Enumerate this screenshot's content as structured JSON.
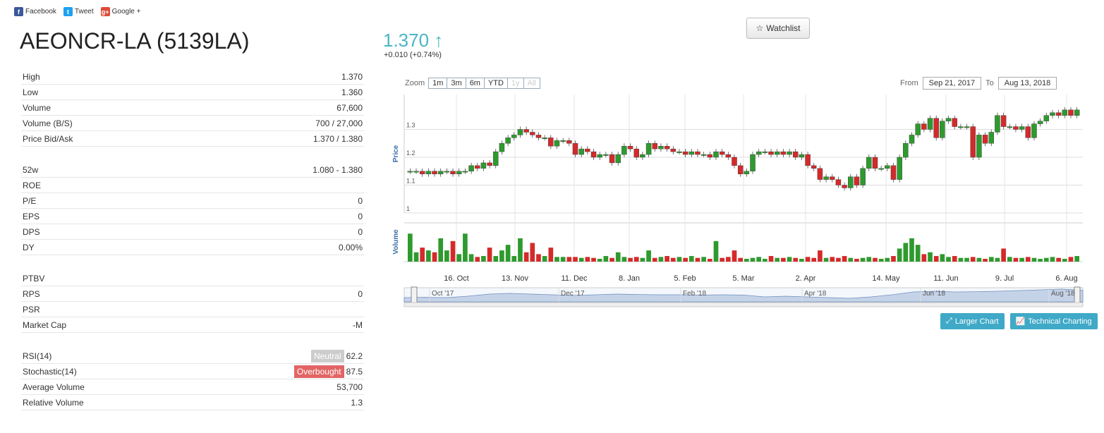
{
  "share": {
    "facebook": "Facebook",
    "tweet": "Tweet",
    "google": "Google +"
  },
  "title": "AEONCR-LA (5139LA)",
  "price": {
    "value": "1.370 ↑",
    "change": "+0.010 (+0.74%)"
  },
  "watchlist": "Watchlist",
  "stats": [
    {
      "label": "High",
      "value": "1.370"
    },
    {
      "label": "Low",
      "value": "1.360"
    },
    {
      "label": "Volume",
      "value": "67,600"
    },
    {
      "label": "Volume (B/S)",
      "value": "700 / 27,000"
    },
    {
      "label": "Price Bid/Ask",
      "value": "1.370 / 1.380"
    },
    {
      "gap": true
    },
    {
      "label": "52w",
      "value": "1.080 - 1.380"
    },
    {
      "label": "ROE",
      "value": ""
    },
    {
      "label": "P/E",
      "value": "0"
    },
    {
      "label": "EPS",
      "value": "0"
    },
    {
      "label": "DPS",
      "value": "0"
    },
    {
      "label": "DY",
      "value": "0.00%"
    },
    {
      "gap": true
    },
    {
      "label": "PTBV",
      "value": ""
    },
    {
      "label": "RPS",
      "value": "0"
    },
    {
      "label": "PSR",
      "value": ""
    },
    {
      "label": "Market Cap",
      "value": "-M"
    },
    {
      "gap": true
    },
    {
      "label": "RSI(14)",
      "value": "62.2",
      "badge": "Neutral",
      "badge_type": "neutral"
    },
    {
      "label": "Stochastic(14)",
      "value": "87.5",
      "badge": "Overbought",
      "badge_type": "overbought"
    },
    {
      "label": "Average Volume",
      "value": "53,700"
    },
    {
      "label": "Relative Volume",
      "value": "1.3"
    }
  ],
  "zoom": {
    "label": "Zoom",
    "buttons": [
      "1m",
      "3m",
      "6m",
      "YTD",
      "1y",
      "All"
    ],
    "disabled": [
      "1y",
      "All"
    ]
  },
  "range": {
    "from_label": "From",
    "from": "Sep 21, 2017",
    "to_label": "To",
    "to": "Aug 13, 2018"
  },
  "buttons": {
    "larger": "Larger Chart",
    "technical": "Technical Charting"
  },
  "colors": {
    "up": "#2e9a2e",
    "down": "#d42a2a",
    "accent": "#4ab6c2",
    "button": "#3fa9c7"
  },
  "chart_data": {
    "type": "candlestick",
    "ylabel": "Price",
    "volume_label": "Volume",
    "y_ticks": [
      "1",
      "1.1",
      "1.2",
      "1.3"
    ],
    "ylim": [
      1.0,
      1.4
    ],
    "x_ticks": [
      "16. Oct",
      "13. Nov",
      "11. Dec",
      "8. Jan",
      "5. Feb",
      "5. Mar",
      "2. Apr",
      "14. May",
      "11. Jun",
      "9. Jul",
      "6. Aug"
    ],
    "navigator_labels": [
      "Oct '17",
      "Dec '17",
      "Feb '18",
      "Apr '18",
      "Jun '18",
      "Aug '18"
    ],
    "closes": [
      1.15,
      1.15,
      1.14,
      1.15,
      1.14,
      1.15,
      1.15,
      1.14,
      1.15,
      1.15,
      1.17,
      1.16,
      1.18,
      1.17,
      1.22,
      1.25,
      1.27,
      1.28,
      1.3,
      1.29,
      1.28,
      1.27,
      1.27,
      1.24,
      1.26,
      1.26,
      1.25,
      1.21,
      1.23,
      1.22,
      1.2,
      1.21,
      1.21,
      1.18,
      1.21,
      1.24,
      1.23,
      1.2,
      1.21,
      1.25,
      1.23,
      1.24,
      1.23,
      1.22,
      1.22,
      1.21,
      1.22,
      1.21,
      1.21,
      1.2,
      1.22,
      1.21,
      1.2,
      1.17,
      1.14,
      1.15,
      1.21,
      1.22,
      1.22,
      1.21,
      1.22,
      1.21,
      1.22,
      1.2,
      1.21,
      1.17,
      1.16,
      1.12,
      1.13,
      1.12,
      1.1,
      1.09,
      1.13,
      1.1,
      1.16,
      1.2,
      1.16,
      1.16,
      1.17,
      1.12,
      1.2,
      1.25,
      1.28,
      1.32,
      1.3,
      1.34,
      1.27,
      1.33,
      1.34,
      1.31,
      1.31,
      1.31,
      1.2,
      1.28,
      1.25,
      1.29,
      1.35,
      1.31,
      1.31,
      1.3,
      1.31,
      1.27,
      1.32,
      1.33,
      1.35,
      1.36,
      1.35,
      1.37,
      1.35,
      1.37
    ],
    "volumes": [
      30,
      10,
      15,
      12,
      10,
      25,
      12,
      22,
      8,
      30,
      8,
      5,
      6,
      15,
      6,
      12,
      18,
      6,
      25,
      10,
      20,
      8,
      6,
      15,
      5,
      5,
      5,
      5,
      4,
      5,
      4,
      3,
      6,
      4,
      10,
      5,
      4,
      5,
      4,
      12,
      4,
      5,
      6,
      4,
      5,
      4,
      6,
      4,
      5,
      3,
      22,
      4,
      5,
      12,
      4,
      3,
      4,
      5,
      3,
      6,
      4,
      4,
      5,
      4,
      3,
      5,
      4,
      12,
      4,
      5,
      4,
      6,
      4,
      3,
      4,
      5,
      4,
      3,
      4,
      6,
      14,
      20,
      25,
      18,
      8,
      10,
      6,
      8,
      5,
      6,
      4,
      4,
      5,
      4,
      3,
      5,
      4,
      14,
      5,
      4,
      4,
      5,
      4,
      3,
      4,
      5,
      4,
      3,
      5,
      6
    ],
    "volume_ylim": [
      0,
      40
    ],
    "navigator": [
      0.3,
      0.32,
      0.3,
      0.4,
      0.55,
      0.6,
      0.55,
      0.5,
      0.45,
      0.5,
      0.55,
      0.52,
      0.5,
      0.5,
      0.48,
      0.5,
      0.48,
      0.35,
      0.4,
      0.35,
      0.3,
      0.25,
      0.35,
      0.5,
      0.7,
      0.75,
      0.7,
      0.72,
      0.75,
      0.8,
      0.85,
      0.9,
      0.82
    ]
  }
}
